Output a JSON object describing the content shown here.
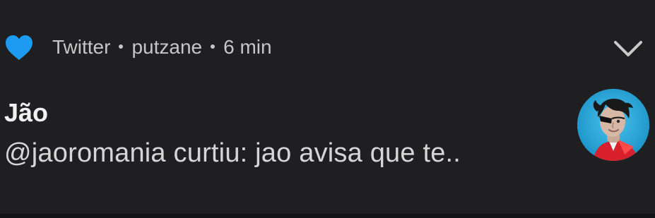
{
  "notification": {
    "app": {
      "name": "Twitter",
      "icon": "heart-icon",
      "color": "#1d9bf0"
    },
    "account": "putzane",
    "time": "6 min",
    "title": "Jão",
    "message": "@jaoromania curtiu: jao avisa que te..",
    "avatar": {
      "icon": "profile-avatar",
      "background": "#2ba7d7"
    }
  },
  "colors": {
    "background": "#1f1f21",
    "text_primary": "#f1f1f1",
    "text_secondary": "#c6c6c6"
  }
}
